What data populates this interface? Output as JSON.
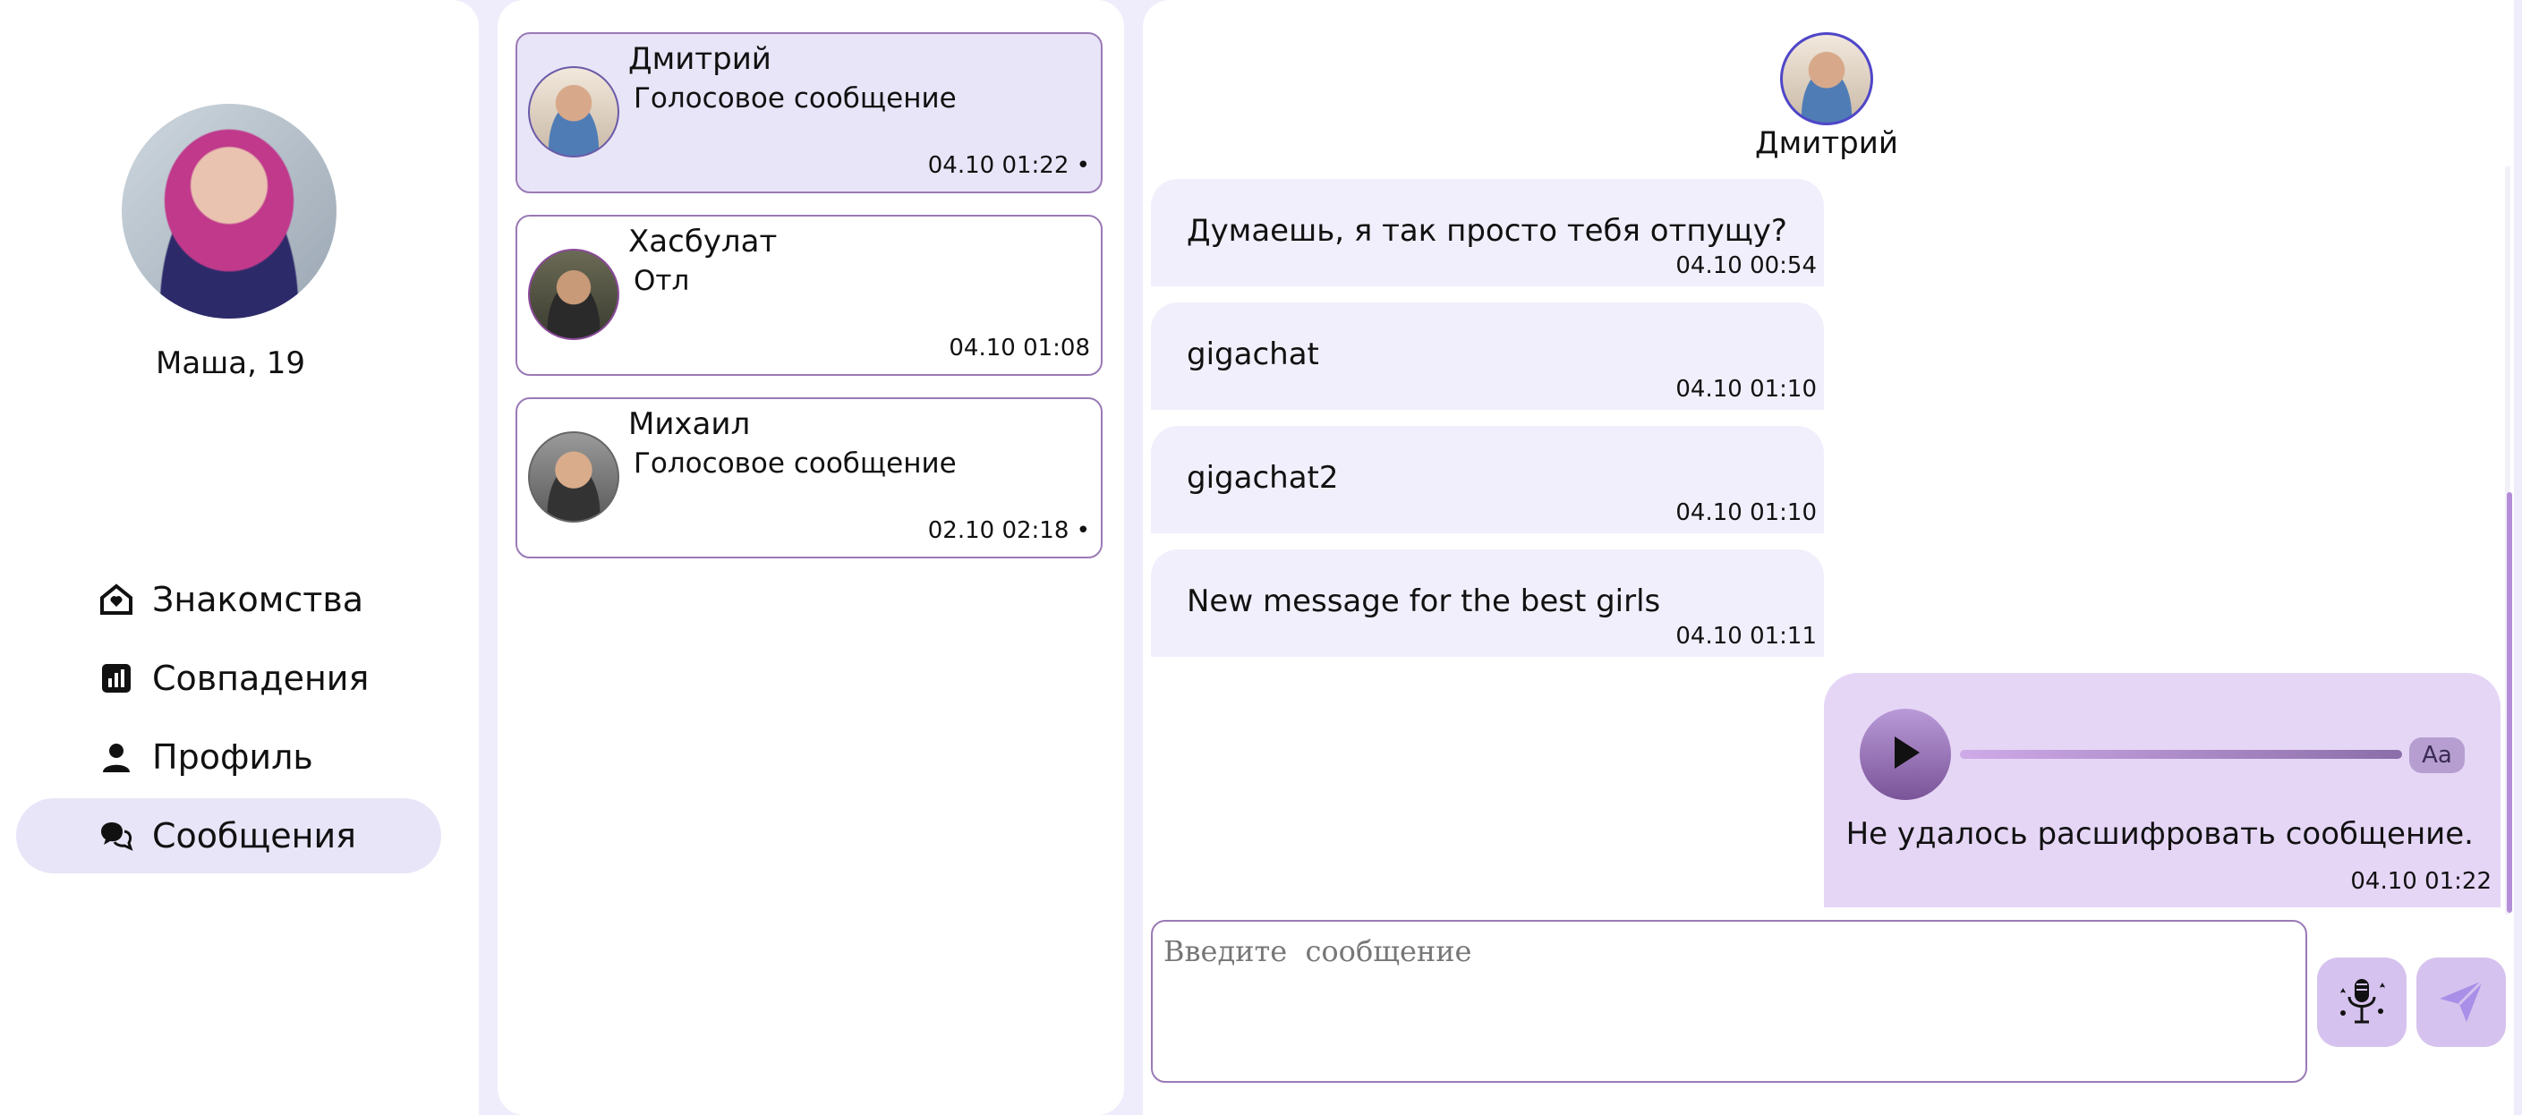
{
  "profile": {
    "name_age": "Маша, 19"
  },
  "nav": {
    "items": [
      {
        "label": "Знакомства",
        "icon": "home-heart-icon"
      },
      {
        "label": "Совпадения",
        "icon": "stats-icon"
      },
      {
        "label": "Профиль",
        "icon": "person-icon"
      },
      {
        "label": "Сообщения",
        "icon": "chat-icon",
        "active": true
      }
    ]
  },
  "dialogs": [
    {
      "name": "Дмитрий",
      "last": "Голосовое сообщение",
      "time": "04.10 01:22 •",
      "active": true
    },
    {
      "name": "Хасбулат",
      "last": "Отл",
      "time": "04.10 01:08"
    },
    {
      "name": "Михаил",
      "last": "Голосовое сообщение",
      "time": "02.10 02:18 •"
    }
  ],
  "chat": {
    "contact_name": "Дмитрий",
    "messages": [
      {
        "text": "Думаешь, я так просто тебя отпущу?",
        "time": "04.10 00:54"
      },
      {
        "text": "gigachat",
        "time": "04.10 01:10"
      },
      {
        "text": "gigachat2",
        "time": "04.10 01:10"
      },
      {
        "text": "New message for the best girls",
        "time": "04.10 01:11"
      }
    ],
    "voice": {
      "transcript": "Не удалось расшифровать сообщение.",
      "time": "04.10 01:22",
      "aa_label": "Aa"
    },
    "input_placeholder": "Введите  сообщение"
  },
  "colors": {
    "accent": "#d6c2ee",
    "active_bg": "#e8e5f8",
    "bubble": "#f1effc",
    "own_bubble": "#e6d6f6"
  }
}
